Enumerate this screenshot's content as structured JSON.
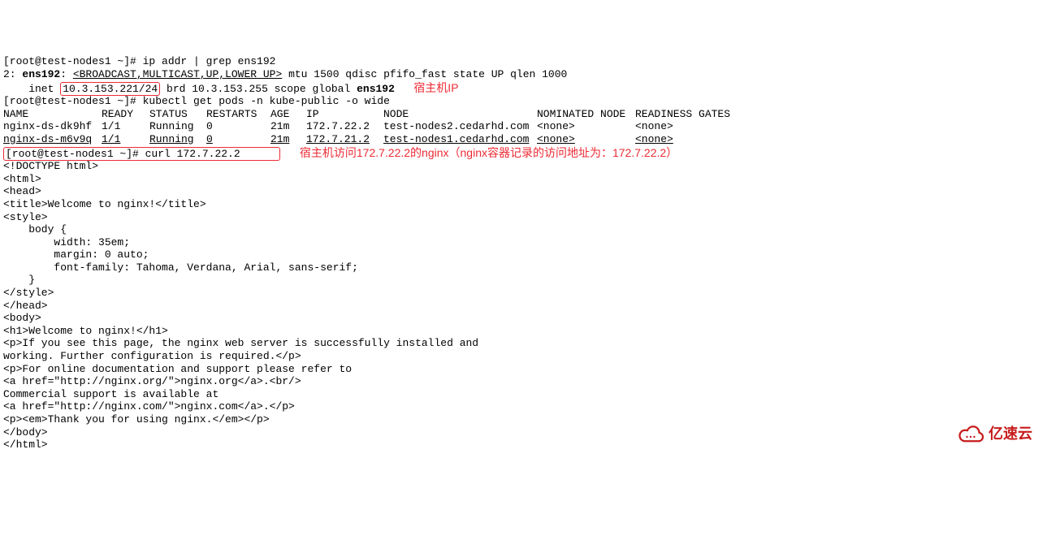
{
  "prompt_user": "root",
  "prompt_host": "test-nodes1",
  "prompt_path": "~",
  "cmd1": "ip addr | grep ens192",
  "cmd1_out_line": "2: ",
  "cmd1_iface": "ens192",
  "cmd1_between": ": ",
  "cmd1_flags": "<BROADCAST,MULTICAST,UP,LOWER_UP>",
  "cmd1_rest": " mtu 1500 qdisc pfifo_fast state UP qlen 1000",
  "cmd1_inet_prefix": "    inet ",
  "cmd1_ip_cidr": "10.3.153.221/24",
  "cmd1_brd": " brd 10.3.153.255 scope global ",
  "cmd1_iface2": "ens192",
  "annotation_host_ip": "宿主机IP",
  "cmd2": "kubectl get pods -n kube-public -o wide",
  "table": {
    "headers": [
      "NAME",
      "READY",
      "STATUS",
      "RESTARTS",
      "AGE",
      "IP",
      "NODE",
      "NOMINATED NODE",
      "READINESS GATES"
    ],
    "rows": [
      [
        "nginx-ds-dk9hf",
        "1/1",
        "Running",
        "0",
        "21m",
        "172.7.22.2",
        "test-nodes2.cedarhd.com",
        "<none>",
        "<none>"
      ],
      [
        "nginx-ds-m6v9q",
        "1/1",
        "Running",
        "0",
        "21m",
        "172.7.21.2",
        "test-nodes1.cedarhd.com",
        "<none>",
        "<none>"
      ]
    ]
  },
  "cmd3": "curl 172.7.22.2",
  "annotation_curl": "宿主机访问172.7.22.2的nginx（nginx容器记录的访问地址为：172.7.22.2）",
  "curl_output_lines": [
    "<!DOCTYPE html>",
    "<html>",
    "<head>",
    "<title>Welcome to nginx!</title>",
    "<style>",
    "    body {",
    "        width: 35em;",
    "        margin: 0 auto;",
    "        font-family: Tahoma, Verdana, Arial, sans-serif;",
    "    }",
    "</style>",
    "</head>",
    "<body>",
    "<h1>Welcome to nginx!</h1>",
    "<p>If you see this page, the nginx web server is successfully installed and",
    "working. Further configuration is required.</p>",
    "",
    "<p>For online documentation and support please refer to",
    "<a href=\"http://nginx.org/\">nginx.org</a>.<br/>",
    "Commercial support is available at",
    "<a href=\"http://nginx.com/\">nginx.com</a>.</p>",
    "",
    "<p><em>Thank you for using nginx.</em></p>",
    "</body>",
    "</html>"
  ],
  "watermark": "亿速云"
}
